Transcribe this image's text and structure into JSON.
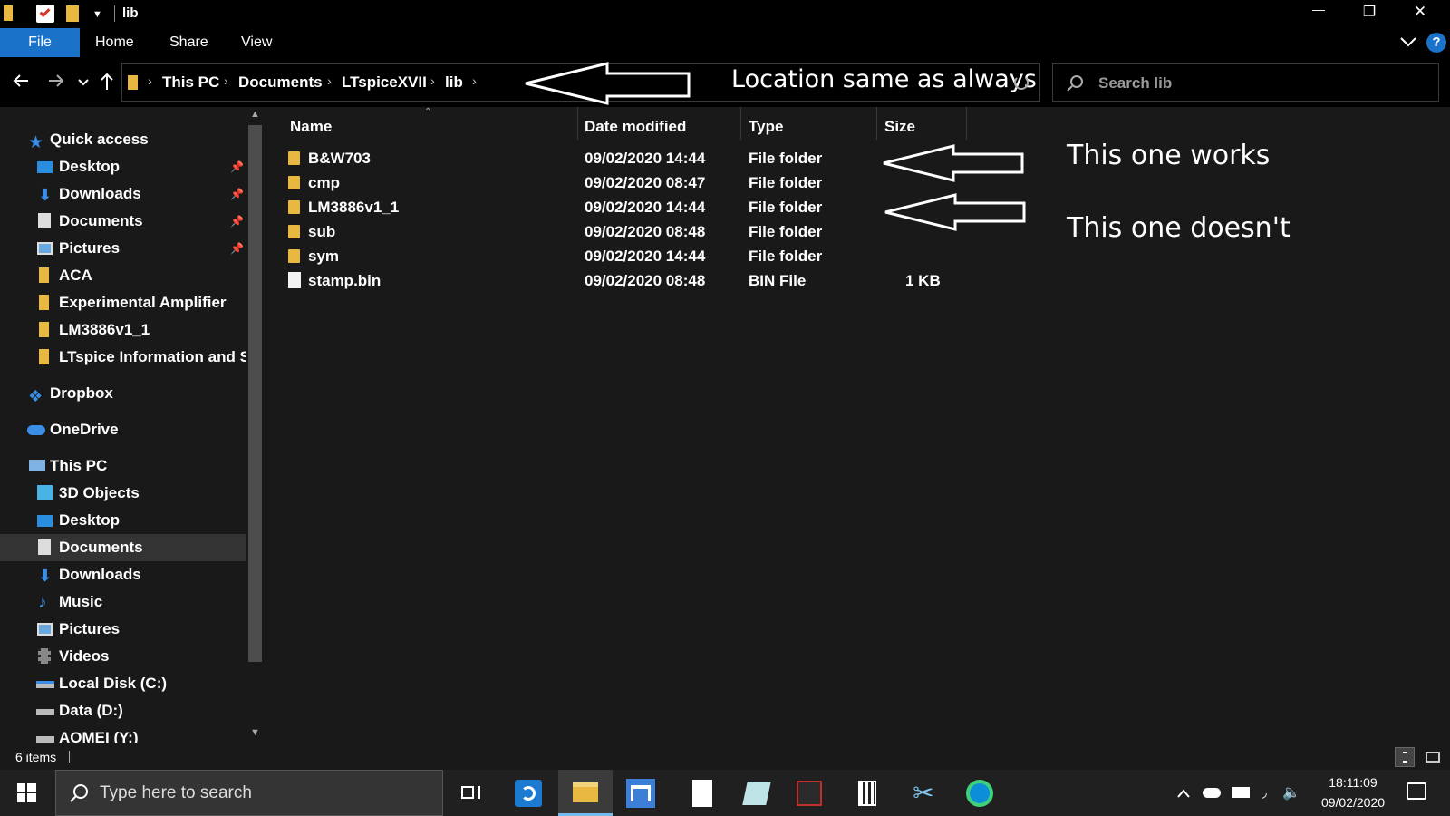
{
  "window": {
    "title": "lib",
    "controls": {
      "minimize": "—",
      "restore": "❐",
      "close": "✕"
    }
  },
  "ribbon": {
    "tabs": [
      "File",
      "Home",
      "Share",
      "View"
    ],
    "help": "?"
  },
  "address": {
    "crumbs": [
      "This PC",
      "Documents",
      "LTspiceXVII",
      "lib"
    ],
    "search_placeholder": "Search lib"
  },
  "sidebar": {
    "quick_access": "Quick access",
    "quick_items": [
      "Desktop",
      "Downloads",
      "Documents",
      "Pictures",
      "ACA",
      "Experimental Amplifier",
      "LM3886v1_1",
      "LTspice Information and S"
    ],
    "dropbox": "Dropbox",
    "onedrive": "OneDrive",
    "this_pc": "This PC",
    "pc_items": [
      "3D Objects",
      "Desktop",
      "Documents",
      "Downloads",
      "Music",
      "Pictures",
      "Videos",
      "Local Disk (C:)",
      "Data (D:)",
      "AOMEI (Y:)"
    ]
  },
  "columns": {
    "name": "Name",
    "date": "Date modified",
    "type": "Type",
    "size": "Size"
  },
  "files": [
    {
      "name": "B&W703",
      "date": "09/02/2020 14:44",
      "type": "File folder",
      "size": "",
      "kind": "folder"
    },
    {
      "name": "cmp",
      "date": "09/02/2020 08:47",
      "type": "File folder",
      "size": "",
      "kind": "folder"
    },
    {
      "name": "LM3886v1_1",
      "date": "09/02/2020 14:44",
      "type": "File folder",
      "size": "",
      "kind": "folder"
    },
    {
      "name": "sub",
      "date": "09/02/2020 08:48",
      "type": "File folder",
      "size": "",
      "kind": "folder"
    },
    {
      "name": "sym",
      "date": "09/02/2020 14:44",
      "type": "File folder",
      "size": "",
      "kind": "folder"
    },
    {
      "name": "stamp.bin",
      "date": "09/02/2020 08:48",
      "type": "BIN File",
      "size": "1 KB",
      "kind": "file"
    }
  ],
  "annotations": {
    "location": "Location same as always",
    "works": "This one works",
    "doesnt": "This one doesn't"
  },
  "status": {
    "items": "6 items"
  },
  "taskbar": {
    "search_placeholder": "Type here to search",
    "time": "18:11:09",
    "date": "09/02/2020"
  },
  "colors": {
    "accent": "#1a73c8",
    "folder": "#e8b840",
    "background": "#191919"
  }
}
